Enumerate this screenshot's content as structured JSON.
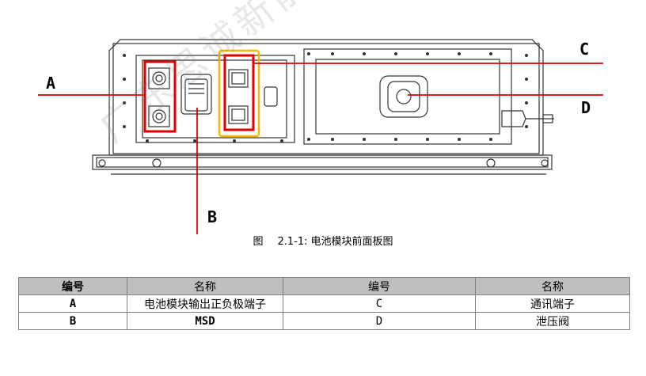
{
  "figure": {
    "watermark": "广东思诚新能",
    "callouts": {
      "a": "A",
      "b": "B",
      "c": "C",
      "d": "D"
    },
    "caption_prefix": "图",
    "caption_number": "2.1-1:",
    "caption_title": "电池模块前面板图",
    "colors": {
      "red": "#e00000",
      "orange": "#f5b800",
      "line": "#333333"
    }
  },
  "table": {
    "headers": [
      "编号",
      "名称",
      "编号",
      "名称"
    ],
    "rows": [
      {
        "id1": "A",
        "name1": "电池模块输出正负极端子",
        "id2": "C",
        "name2": "通讯端子"
      },
      {
        "id1": "B",
        "name1": "MSD",
        "id2": "D",
        "name2": "泄压阀"
      }
    ]
  }
}
